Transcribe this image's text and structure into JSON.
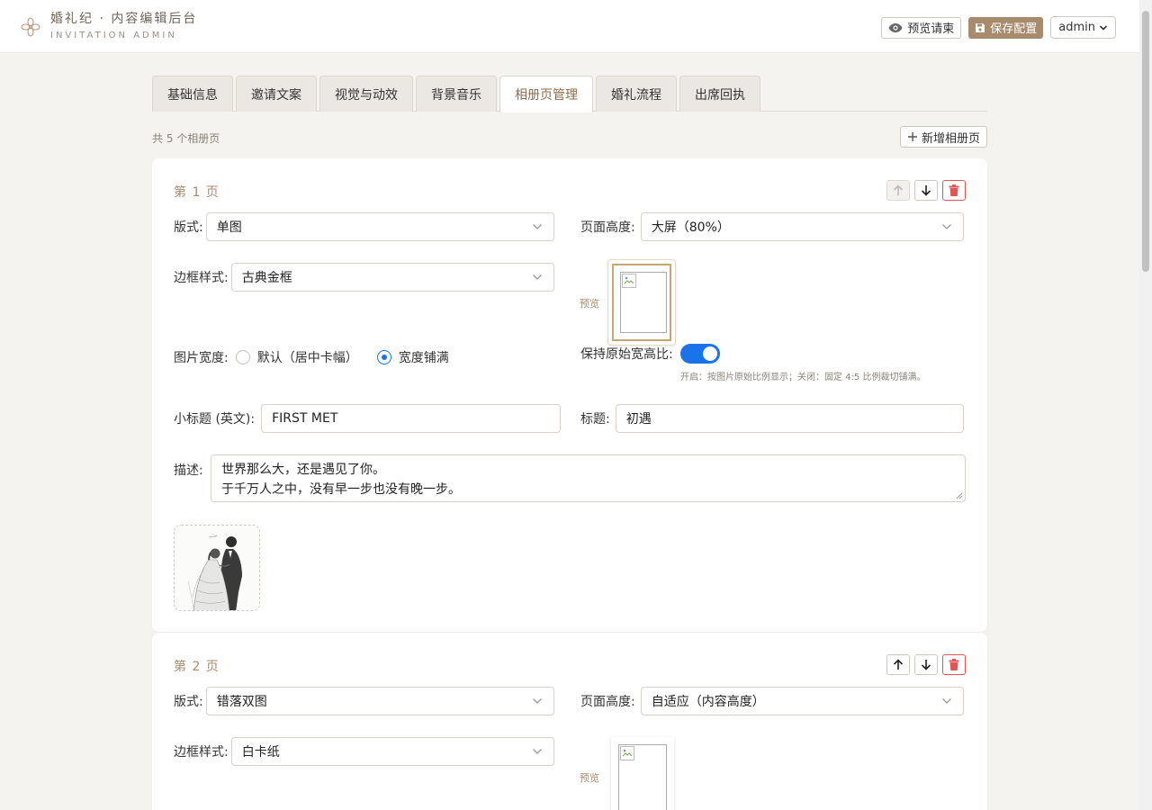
{
  "header": {
    "title": "婚礼纪 · 内容编辑后台",
    "subtitle": "INVITATION ADMIN",
    "preview_label": "预览请柬",
    "save_label": "保存配置",
    "user_label": "admin"
  },
  "tabs": [
    {
      "label": "基础信息",
      "active": false
    },
    {
      "label": "邀请文案",
      "active": false
    },
    {
      "label": "视觉与动效",
      "active": false
    },
    {
      "label": "背景音乐",
      "active": false
    },
    {
      "label": "相册页管理",
      "active": true
    },
    {
      "label": "婚礼流程",
      "active": false
    },
    {
      "label": "出席回执",
      "active": false
    }
  ],
  "album": {
    "count_text": "共 5 个相册页",
    "add_label": "新增相册页"
  },
  "labels": {
    "layout": "版式:",
    "height": "页面高度:",
    "border": "边框样式:",
    "preview": "预览",
    "width": "图片宽度:",
    "width_default": "默认（居中卡幅）",
    "width_full": "宽度铺满",
    "keep_ratio": "保持原始宽高比:",
    "keep_ratio_hint": "开启：按图片原始比例显示；关闭：固定 4:5 比例裁切铺满。",
    "subtitle": "小标题 (英文):",
    "title": "标题:",
    "desc": "描述:"
  },
  "pages": [
    {
      "title": "第 1 页",
      "layout": "单图",
      "height": "大屏（80%）",
      "border": "古典金框",
      "width_mode": "full",
      "keep_ratio": true,
      "subtitle": "FIRST MET",
      "heading": "初遇",
      "desc_line1": "世界那么大，还是遇见了你。",
      "desc_line2": "于千万人之中，没有早一步也没有晚一步。"
    },
    {
      "title": "第 2 页",
      "layout": "错落双图",
      "height": "自适应（内容高度）",
      "border": "白卡纸"
    }
  ],
  "colors": {
    "accent": "#a88b6c",
    "primary_blue": "#1a73e8",
    "danger": "#e25555",
    "page_bg": "#f5f3ef"
  }
}
